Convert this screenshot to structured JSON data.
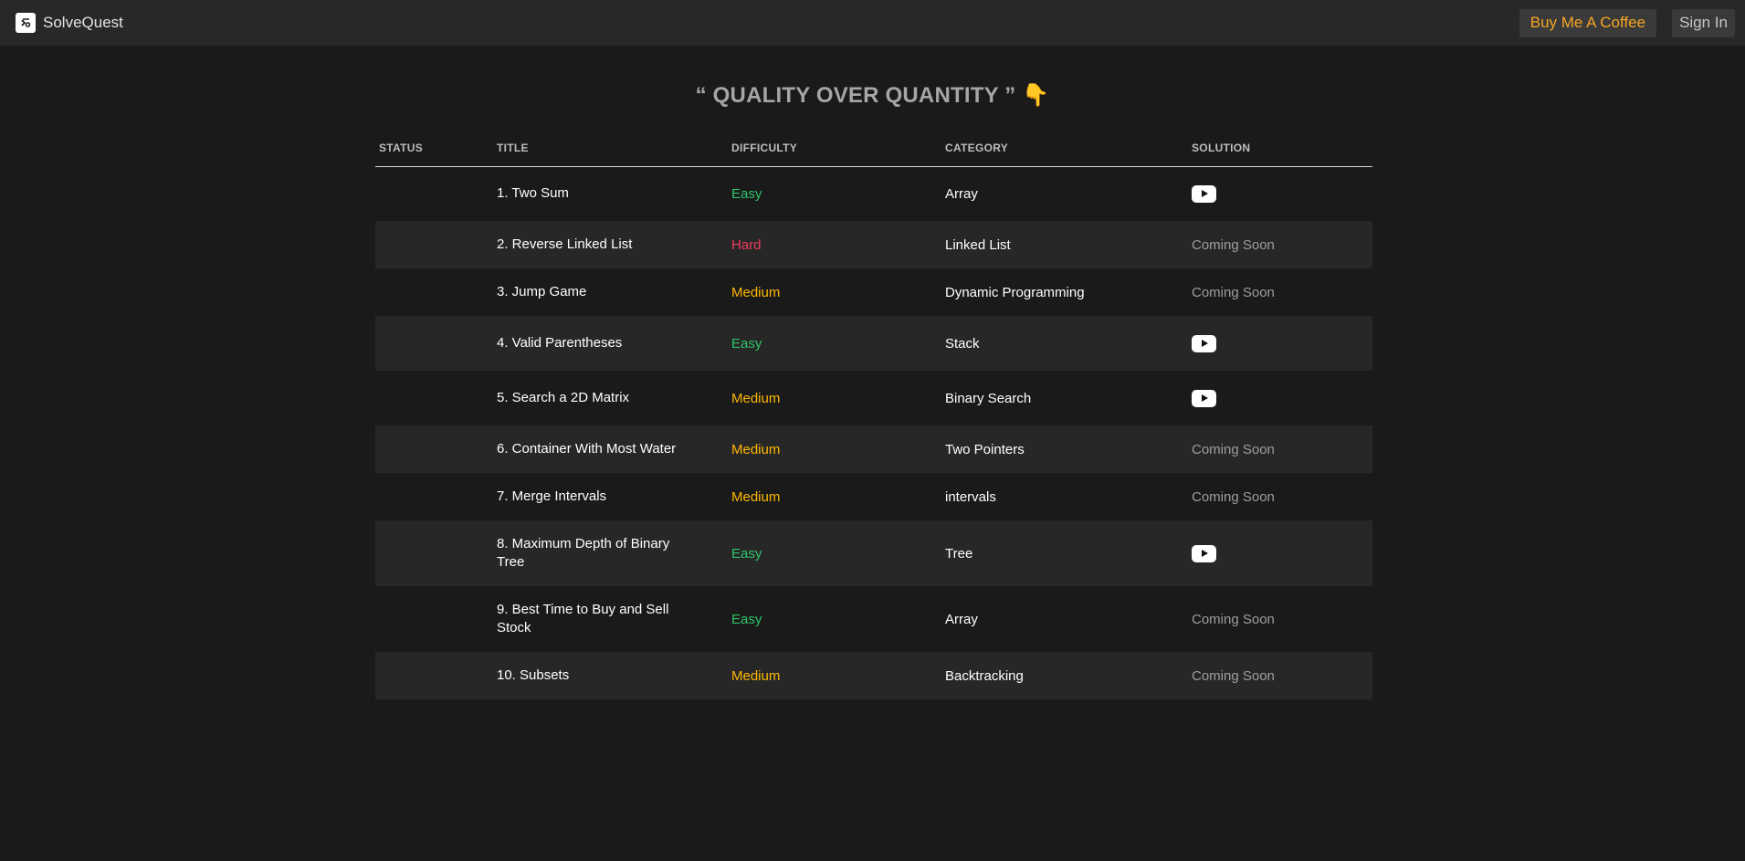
{
  "header": {
    "brand": "SolveQuest",
    "coffee_label": "Buy Me A Coffee",
    "signin_label": "Sign In"
  },
  "headline": {
    "text": "“ QUALITY OVER QUANTITY ”",
    "emoji": "👇"
  },
  "table": {
    "columns": [
      "STATUS",
      "TITLE",
      "DIFFICULTY",
      "CATEGORY",
      "SOLUTION"
    ],
    "rows": [
      {
        "status": "",
        "title": "1. Two Sum",
        "difficulty": "Easy",
        "category": "Array",
        "solution": "youtube-icon"
      },
      {
        "status": "",
        "title": "2. Reverse Linked List",
        "difficulty": "Hard",
        "category": "Linked List",
        "solution": "Coming Soon"
      },
      {
        "status": "",
        "title": "3. Jump Game",
        "difficulty": "Medium",
        "category": "Dynamic Programming",
        "solution": "Coming Soon"
      },
      {
        "status": "",
        "title": "4. Valid Parentheses",
        "difficulty": "Easy",
        "category": "Stack",
        "solution": "youtube-icon"
      },
      {
        "status": "",
        "title": "5. Search a 2D Matrix",
        "difficulty": "Medium",
        "category": "Binary Search",
        "solution": "youtube-icon"
      },
      {
        "status": "",
        "title": "6. Container With Most Water",
        "difficulty": "Medium",
        "category": "Two Pointers",
        "solution": "Coming Soon"
      },
      {
        "status": "",
        "title": "7. Merge Intervals",
        "difficulty": "Medium",
        "category": "intervals",
        "solution": "Coming Soon"
      },
      {
        "status": "",
        "title": "8. Maximum Depth of Binary Tree",
        "difficulty": "Easy",
        "category": "Tree",
        "solution": "youtube-icon"
      },
      {
        "status": "",
        "title": "9. Best Time to Buy and Sell Stock",
        "difficulty": "Easy",
        "category": "Array",
        "solution": "Coming Soon"
      },
      {
        "status": "",
        "title": "10. Subsets",
        "difficulty": "Medium",
        "category": "Backtracking",
        "solution": "Coming Soon"
      }
    ]
  },
  "colors": {
    "easy": "#2fc46a",
    "medium": "#ffb800",
    "hard": "#ef3d5a",
    "accent": "#f5a623"
  }
}
